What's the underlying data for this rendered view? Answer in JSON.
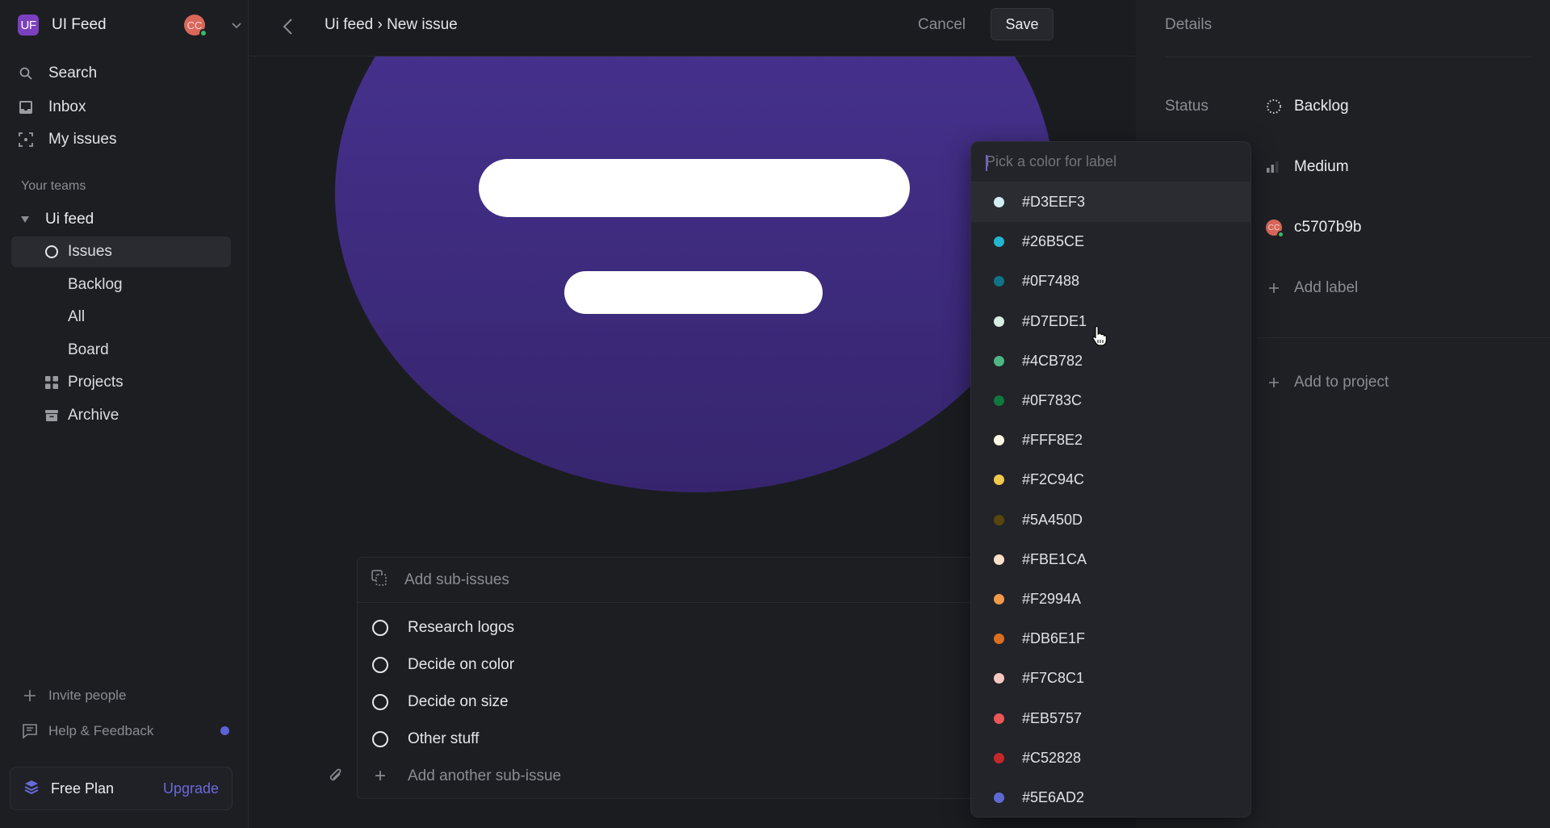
{
  "sidebar": {
    "workspace": {
      "logo": "UF",
      "name": "UI Feed",
      "avatar_initials": "CC"
    },
    "nav": [
      {
        "label": "Search",
        "icon": "search-icon"
      },
      {
        "label": "Inbox",
        "icon": "inbox-icon"
      },
      {
        "label": "My issues",
        "icon": "my-issues-icon"
      }
    ],
    "teams_label": "Your teams",
    "team": {
      "name": "Ui feed",
      "items": [
        {
          "label": "Issues",
          "icon": "circle-icon",
          "active": true
        },
        {
          "label": "Backlog"
        },
        {
          "label": "All"
        },
        {
          "label": "Board"
        },
        {
          "label": "Projects",
          "icon": "grid-icon"
        },
        {
          "label": "Archive",
          "icon": "archive-icon"
        }
      ]
    },
    "footer": {
      "invite": "Invite people",
      "help": "Help & Feedback",
      "plan": "Free Plan",
      "upgrade": "Upgrade"
    }
  },
  "topbar": {
    "breadcrumb": "Ui feed › New issue",
    "cancel": "Cancel",
    "save": "Save"
  },
  "subissues": {
    "header": "Add sub-issues",
    "items": [
      "Research logos",
      "Decide on color",
      "Decide on size",
      "Other stuff"
    ],
    "add": "Add another sub-issue"
  },
  "details": {
    "title": "Details",
    "status_label": "Status",
    "status": "Backlog",
    "priority": "Medium",
    "assignee": "c5707b9b",
    "assignee_initials": "CC",
    "add_label": "Add label",
    "add_project": "Add to project"
  },
  "picker": {
    "placeholder": "Pick a color for label",
    "colors": [
      "#D3EEF3",
      "#26B5CE",
      "#0F7488",
      "#D7EDE1",
      "#4CB782",
      "#0F783C",
      "#FFF8E2",
      "#F2C94C",
      "#5A450D",
      "#FBE1CA",
      "#F2994A",
      "#DB6E1F",
      "#F7C8C1",
      "#EB5757",
      "#C52828",
      "#5E6AD2"
    ],
    "highlighted_index": 0
  },
  "colors": {
    "accent": "#5E62D6",
    "hero": "#4A3596",
    "online": "#3CB96A",
    "avatar": "#D9675A"
  }
}
